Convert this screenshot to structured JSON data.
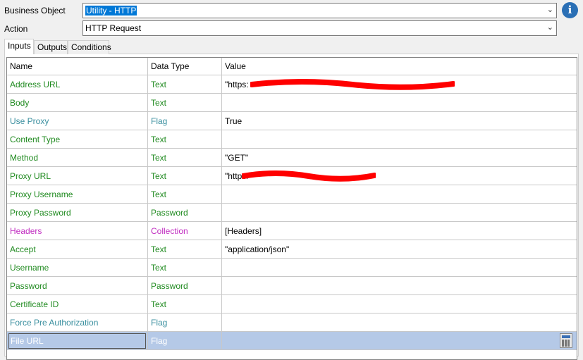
{
  "business_object": {
    "label": "Business Object",
    "value": "Utility - HTTP"
  },
  "action": {
    "label": "Action",
    "value": "HTTP Request"
  },
  "info_icon": "i",
  "tabs": [
    {
      "label": "Inputs"
    },
    {
      "label": "Outputs"
    },
    {
      "label": "Conditions"
    }
  ],
  "columns": [
    "Name",
    "Data Type",
    "Value"
  ],
  "colors": {
    "text": "#218b21",
    "flag": "#3a8f9f",
    "collection": "#c02cc0",
    "selected": "#b5c9e7"
  },
  "rows": [
    {
      "name": "Address URL",
      "type": "Text",
      "value": "\"https:",
      "kind": "text",
      "redacted": true
    },
    {
      "name": "Body",
      "type": "Text",
      "value": "",
      "kind": "text"
    },
    {
      "name": "Use Proxy",
      "type": "Flag",
      "value": "True",
      "kind": "flag"
    },
    {
      "name": "Content Type",
      "type": "Text",
      "value": "",
      "kind": "text"
    },
    {
      "name": "Method",
      "type": "Text",
      "value": "\"GET\"",
      "kind": "text"
    },
    {
      "name": "Proxy URL",
      "type": "Text",
      "value": "\"http://",
      "kind": "text",
      "redacted": true
    },
    {
      "name": "Proxy Username",
      "type": "Text",
      "value": "",
      "kind": "text"
    },
    {
      "name": "Proxy Password",
      "type": "Password",
      "value": "",
      "kind": "text"
    },
    {
      "name": "Headers",
      "type": "Collection",
      "value": "[Headers]",
      "kind": "collection"
    },
    {
      "name": "Accept",
      "type": "Text",
      "value": "\"application/json\"",
      "kind": "text"
    },
    {
      "name": "Username",
      "type": "Text",
      "value": "",
      "kind": "text"
    },
    {
      "name": "Password",
      "type": "Password",
      "value": "",
      "kind": "text"
    },
    {
      "name": "Certificate ID",
      "type": "Text",
      "value": "",
      "kind": "text"
    },
    {
      "name": "Force Pre Authorization",
      "type": "Flag",
      "value": "",
      "kind": "flag"
    },
    {
      "name": "File URL",
      "type": "Flag",
      "value": "",
      "kind": "selected"
    }
  ]
}
